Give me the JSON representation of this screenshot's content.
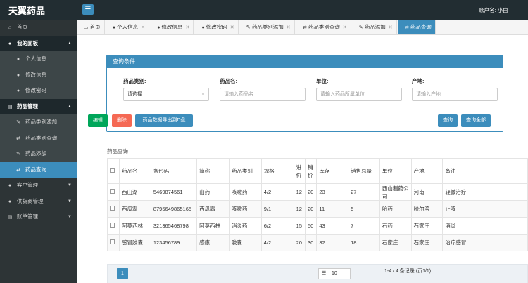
{
  "app_title": "天翼药品",
  "toggle_icon": "☰",
  "user_text": "账户名: 小白",
  "sidebar": {
    "home": "首页",
    "my_panel": "我的面板",
    "personal_info": "个人信息",
    "edit_info": "修改信息",
    "change_password": "修改密码",
    "drug_management": "药品管理",
    "drug_category_add": "药品类别添加",
    "drug_category_query": "药品类别查询",
    "drug_add": "药品添加",
    "drug_query": "药品查询",
    "customer_management": "客户管理",
    "supplier_management": "供货商管理",
    "bill_management": "账单管理"
  },
  "tabs": [
    "首页",
    "个人信息",
    "修改信息",
    "修改密码",
    "药品类别添加",
    "药品类别查询",
    "药品添加",
    "药品查询"
  ],
  "query_panel": {
    "title": "查询条件",
    "category_label": "药品类别:",
    "category_value": "请选择",
    "name_label": "药品名:",
    "name_placeholder": "请输入药品名",
    "unit_label": "单位:",
    "unit_placeholder": "请输入药品所属单位",
    "origin_label": "产地:",
    "origin_placeholder": "请输入产地"
  },
  "buttons": {
    "edit": "编辑",
    "delete": "删除",
    "export": "药品数据导出到D盘",
    "query": "查询",
    "query_all": "查询全部"
  },
  "table": {
    "title": "药品查询",
    "headers": [
      "药品名",
      "条形码",
      "简称",
      "药品类别",
      "规格",
      "进价",
      "销价",
      "库存",
      "销售总量",
      "单位",
      "产地",
      "备注"
    ],
    "rows": [
      [
        "西山湖",
        "5469874561",
        "山药",
        "咳嗽药",
        "4/2",
        "12",
        "20",
        "23",
        "27",
        "西山制药公司",
        "河南",
        "轻微治疗"
      ],
      [
        "西瓜霜",
        "8795649865165",
        "西瓜霜",
        "咳嗽药",
        "9/1",
        "12",
        "20",
        "11",
        "5",
        "哈药",
        "哈尔滨",
        "止咳"
      ],
      [
        "阿莫西林",
        "321365468798",
        "阿莫西林",
        "消炎药",
        "6/2",
        "15",
        "50",
        "43",
        "7",
        "石药",
        "石家庄",
        "消炎"
      ],
      [
        "感冒胶囊",
        "123456789",
        "感康",
        "胶囊",
        "4/2",
        "20",
        "30",
        "32",
        "18",
        "石家庄",
        "石家庄",
        "治疗感冒"
      ]
    ]
  },
  "pager": {
    "current_page": "1",
    "page_size": "10",
    "info": "1-4 / 4 条记录 (页1/1)"
  }
}
